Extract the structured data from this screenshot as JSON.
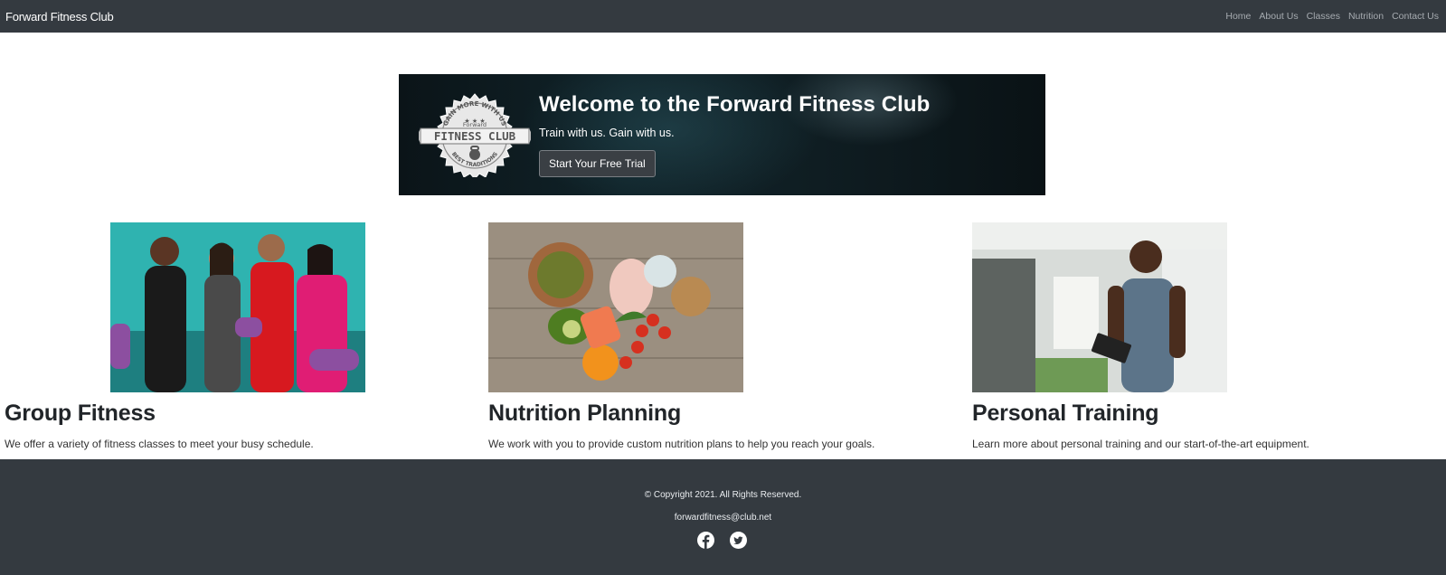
{
  "nav": {
    "brand": "Forward Fitness Club",
    "links": [
      "Home",
      "About Us",
      "Classes",
      "Nutrition",
      "Contact Us"
    ]
  },
  "hero": {
    "logo_text_top": "GAIN MORE WITH US",
    "logo_text_forward": "Forward",
    "logo_text_main": "FITNESS CLUB",
    "logo_text_bottom": "BEST TRADITIONS",
    "title": "Welcome to the Forward Fitness Club",
    "subtitle": "Train with us. Gain with us.",
    "button_label": "Start Your Free Trial"
  },
  "cards": [
    {
      "title": "Group Fitness",
      "text": "We offer a variety of fitness classes to meet your busy schedule."
    },
    {
      "title": "Nutrition Planning",
      "text": "We work with you to provide custom nutrition plans to help you reach your goals."
    },
    {
      "title": "Personal Training",
      "text": "Learn more about personal training and our start-of-the-art equipment."
    }
  ],
  "footer": {
    "copyright": "© Copyright 2021. All Rights Reserved.",
    "email": "forwardfitness@club.net",
    "social_icons": [
      "facebook-icon",
      "twitter-icon"
    ]
  },
  "colors": {
    "navbar_bg": "#343a40",
    "footer_bg": "#343a40"
  }
}
